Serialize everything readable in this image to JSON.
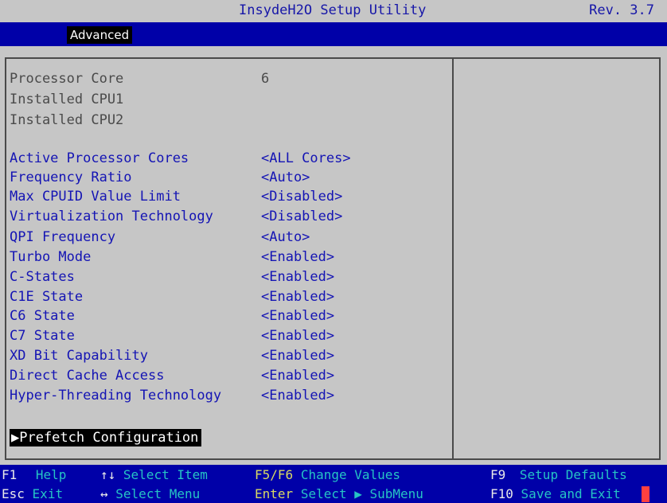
{
  "header": {
    "title": "InsydeH2O Setup Utility",
    "revision": "Rev. 3.7"
  },
  "nav": {
    "active_tab": "Advanced"
  },
  "info_rows": [
    {
      "label": "Processor Core",
      "value": "6"
    },
    {
      "label": "Installed CPU1",
      "value": ""
    },
    {
      "label": "Installed CPU2",
      "value": ""
    }
  ],
  "options": [
    {
      "label": "Active Processor Cores",
      "value": "<ALL Cores>"
    },
    {
      "label": "Frequency Ratio",
      "value": "<Auto>"
    },
    {
      "label": "Max CPUID Value Limit",
      "value": "<Disabled>"
    },
    {
      "label": "Virtualization Technology",
      "value": "<Disabled>"
    },
    {
      "label": "QPI Frequency",
      "value": "<Auto>"
    },
    {
      "label": "Turbo Mode",
      "value": "<Enabled>"
    },
    {
      "label": "C-States",
      "value": "<Enabled>"
    },
    {
      "label": "C1E State",
      "value": "<Enabled>"
    },
    {
      "label": "C6 State",
      "value": "<Enabled>"
    },
    {
      "label": "C7 State",
      "value": "<Enabled>"
    },
    {
      "label": "XD Bit Capability",
      "value": "<Enabled>"
    },
    {
      "label": "Direct Cache Access",
      "value": "<Enabled>"
    },
    {
      "label": "Hyper-Threading Technology",
      "value": "<Enabled>"
    }
  ],
  "submenu": {
    "label": "▶Prefetch Configuration"
  },
  "footer": {
    "help_key": "F1",
    "help_action": "Help",
    "esc_key": "Esc",
    "esc_action": "Exit",
    "select_item_key": "↑↓",
    "select_item_action": "Select Item",
    "select_menu_key": "↔",
    "select_menu_action": "Select Menu",
    "change_key": "F5/F6",
    "change_action": "Change Values",
    "enter_key": "Enter",
    "enter_action": "Select ▶ SubMenu",
    "defaults_key": "F9",
    "defaults_action": "Setup Defaults",
    "save_key": "F10",
    "save_action": "Save and Exit"
  },
  "colors": {
    "background": "#c6c6c6",
    "header_bar": "#0000a8",
    "option_text": "#1414b4",
    "info_text": "#4a4a4a",
    "footer_key": "#e8e8e8",
    "footer_action": "#26c4c4",
    "cursor": "#ff4040"
  }
}
